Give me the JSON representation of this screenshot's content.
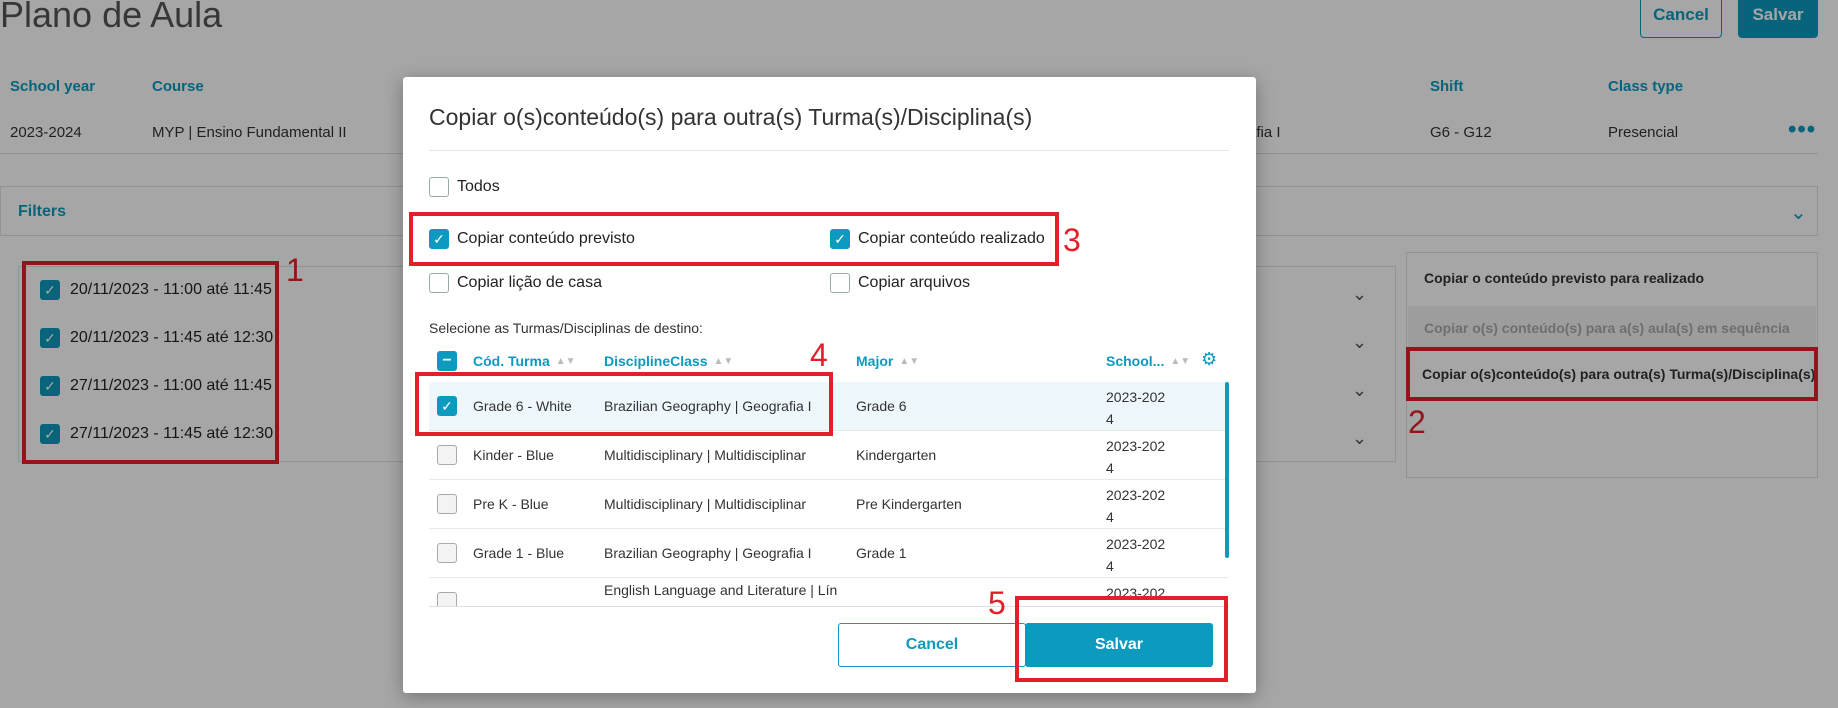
{
  "page": {
    "title": "Plano de Aula",
    "cancel_label": "Cancel",
    "save_label": "Salvar"
  },
  "info": {
    "headers": [
      "School year",
      "Course",
      "Shift",
      "Class type"
    ],
    "values": [
      "2023-2024",
      "MYP | Ensino Fundamental II",
      "afia I",
      "G6 - G12",
      "Presencial"
    ]
  },
  "filters": {
    "label": "Filters"
  },
  "lessons": [
    "20/11/2023 - 11:00 até 11:45",
    "20/11/2023 - 11:45 até 12:30",
    "27/11/2023 - 11:00 até 11:45",
    "27/11/2023 - 11:45 até 12:30"
  ],
  "actions": [
    "Copiar o conteúdo previsto para realizado",
    "Copiar o(s) conteúdo(s) para a(s) aula(s) em sequência",
    "Copiar o(s)conteúdo(s) para outra(s) Turma(s)/Disciplina(s)"
  ],
  "annotations": [
    "1",
    "2",
    "3",
    "4",
    "5"
  ],
  "modal": {
    "title": "Copiar o(s)conteúdo(s) para outra(s) Turma(s)/Disciplina(s)",
    "options": {
      "todos": "Todos",
      "previsto": "Copiar conteúdo previsto",
      "realizado": "Copiar conteúdo realizado",
      "licao": "Copiar lição de casa",
      "arquivos": "Copiar arquivos"
    },
    "dest_label": "Selecione as Turmas/Disciplinas de destino:",
    "columns": [
      "Cód. Turma",
      "DisciplineClass",
      "Major",
      "School..."
    ],
    "rows": [
      {
        "turma": "Grade 6 - White",
        "discipline": "Brazilian Geography | Geografia I",
        "major": "Grade 6",
        "year_a": "2023-202",
        "year_b": "4",
        "checked": true
      },
      {
        "turma": "Kinder - Blue",
        "discipline": "Multidisciplinary | Multidisciplinar",
        "major": "Kindergarten",
        "year_a": "2023-202",
        "year_b": "4",
        "checked": false
      },
      {
        "turma": "Pre K - Blue",
        "discipline": "Multidisciplinary | Multidisciplinar",
        "major": "Pre Kindergarten",
        "year_a": "2023-202",
        "year_b": "4",
        "checked": false
      },
      {
        "turma": "Grade 1 - Blue",
        "discipline": "Brazilian Geography | Geografia I",
        "major": "Grade 1",
        "year_a": "2023-202",
        "year_b": "4",
        "checked": false
      },
      {
        "turma": "",
        "discipline": "English Language and Literature | Lín",
        "major": "",
        "year_a": "2023-202",
        "year_b": "",
        "checked": false
      }
    ],
    "cancel_label": "Cancel",
    "save_label": "Salvar"
  },
  "colors": {
    "accent": "#0c9abe",
    "annotation": "#e3202a"
  }
}
